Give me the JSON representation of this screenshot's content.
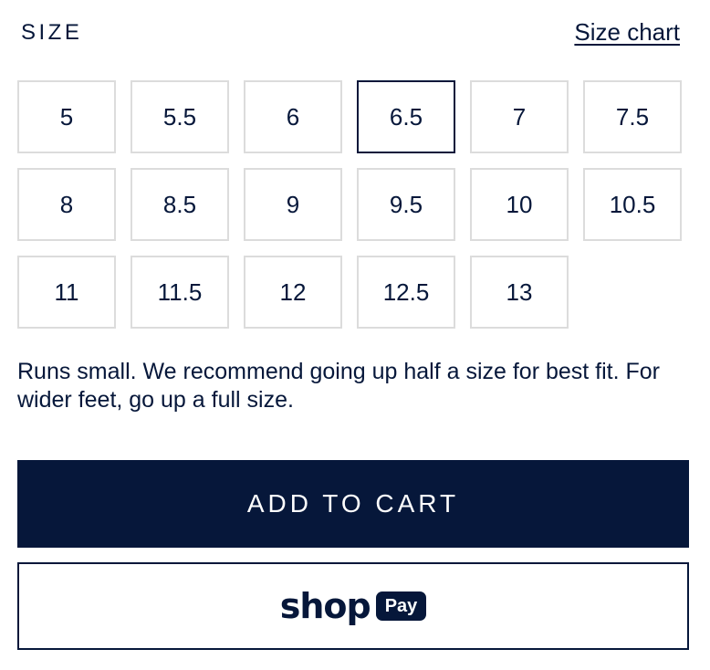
{
  "size_section": {
    "title": "SIZE",
    "size_chart_label": "Size chart"
  },
  "sizes": {
    "options": [
      "5",
      "5.5",
      "6",
      "6.5",
      "7",
      "7.5",
      "8",
      "8.5",
      "9",
      "9.5",
      "10",
      "10.5",
      "11",
      "11.5",
      "12",
      "12.5",
      "13"
    ],
    "selected": "6.5"
  },
  "fit_note": "Runs small. We recommend going up half a size for best fit. For wider feet, go up a full size.",
  "add_to_cart_label": "ADD TO CART",
  "shop_pay": {
    "shop_text": "shop",
    "pay_text": "Pay"
  },
  "colors": {
    "navy": "#06173a",
    "border_gray": "#dcdcdc",
    "white": "#ffffff"
  }
}
